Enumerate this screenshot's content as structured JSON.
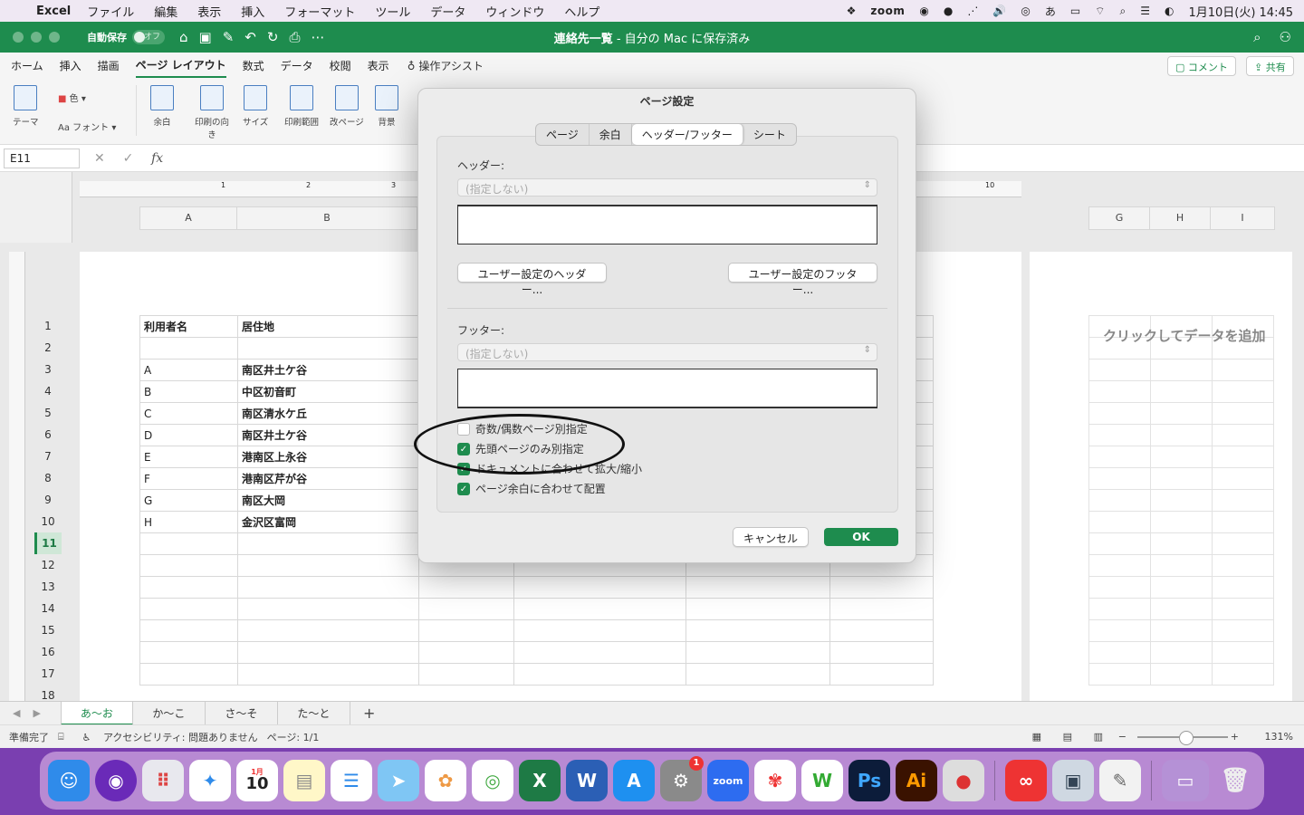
{
  "menubar": {
    "app": "Excel",
    "items": [
      "ファイル",
      "編集",
      "表示",
      "挿入",
      "フォーマット",
      "ツール",
      "データ",
      "ウィンドウ",
      "ヘルプ"
    ],
    "zoom": "zoom",
    "ime": "あ",
    "clock": "1月10日(火) 14:45"
  },
  "titlebar": {
    "autosave": "自動保存",
    "autosave_state": "オフ",
    "doc_name": "連絡先一覧",
    "doc_status": " - 自分の Mac に保存済み"
  },
  "ribbon": {
    "tabs": [
      "ホーム",
      "挿入",
      "描画",
      "ページ レイアウト",
      "数式",
      "データ",
      "校閲",
      "表示"
    ],
    "assist": "操作アシスト",
    "comment": "コメント",
    "share": "共有",
    "groups": [
      "テーマ",
      "色",
      "フォント",
      "余白",
      "印刷の向き",
      "サイズ",
      "印刷範囲",
      "改ページ",
      "背景"
    ]
  },
  "formula": {
    "namebox": "E11",
    "fx": "fx"
  },
  "sheet": {
    "columns": [
      "A",
      "B",
      "G",
      "H",
      "I"
    ],
    "rows": [
      "1",
      "2",
      "3",
      "4",
      "5",
      "6",
      "7",
      "8",
      "9",
      "10",
      "11",
      "12",
      "13",
      "14",
      "15",
      "16",
      "17",
      "18"
    ],
    "header": [
      "利用者名",
      "居住地"
    ],
    "data": [
      [
        "A",
        "南区井土ケ谷"
      ],
      [
        "B",
        "中区初音町"
      ],
      [
        "C",
        "南区清水ケ丘"
      ],
      [
        "D",
        "南区井土ケ谷"
      ],
      [
        "E",
        "港南区上永谷"
      ],
      [
        "F",
        "港南区芹が谷"
      ],
      [
        "G",
        "南区大岡"
      ],
      [
        "H",
        "金沢区富岡"
      ]
    ],
    "add_data": "クリックしてデータを追加",
    "ruler_marks": [
      "1",
      "2",
      "3",
      "10"
    ]
  },
  "sheettabs": [
    "あ～お",
    "か～こ",
    "さ～そ",
    "た～と"
  ],
  "status": {
    "ready": "準備完了",
    "accessibility": "アクセシビリティ: 問題ありません",
    "page": "ページ: 1/1",
    "zoom": "131%"
  },
  "dialog": {
    "title": "ページ設定",
    "tabs": [
      "ページ",
      "余白",
      "ヘッダー/フッター",
      "シート"
    ],
    "header_label": "ヘッダー:",
    "header_value": "(指定しない)",
    "custom_header": "ユーザー設定のヘッダー...",
    "custom_footer": "ユーザー設定のフッター...",
    "footer_label": "フッター:",
    "footer_value": "(指定しない)",
    "checks": [
      {
        "label": "奇数/偶数ページ別指定",
        "checked": false
      },
      {
        "label": "先頭ページのみ別指定",
        "checked": true
      },
      {
        "label": "ドキュメントに合わせて拡大/縮小",
        "checked": true
      },
      {
        "label": "ページ余白に合わせて配置",
        "checked": true
      }
    ],
    "cancel": "キャンセル",
    "ok": "OK"
  },
  "dock": {
    "calendar_month": "1月",
    "calendar_day": "10",
    "settings_badge": "1",
    "zoom": "zoom",
    "word": "W",
    "ps": "Ps",
    "ai": "Ai"
  }
}
